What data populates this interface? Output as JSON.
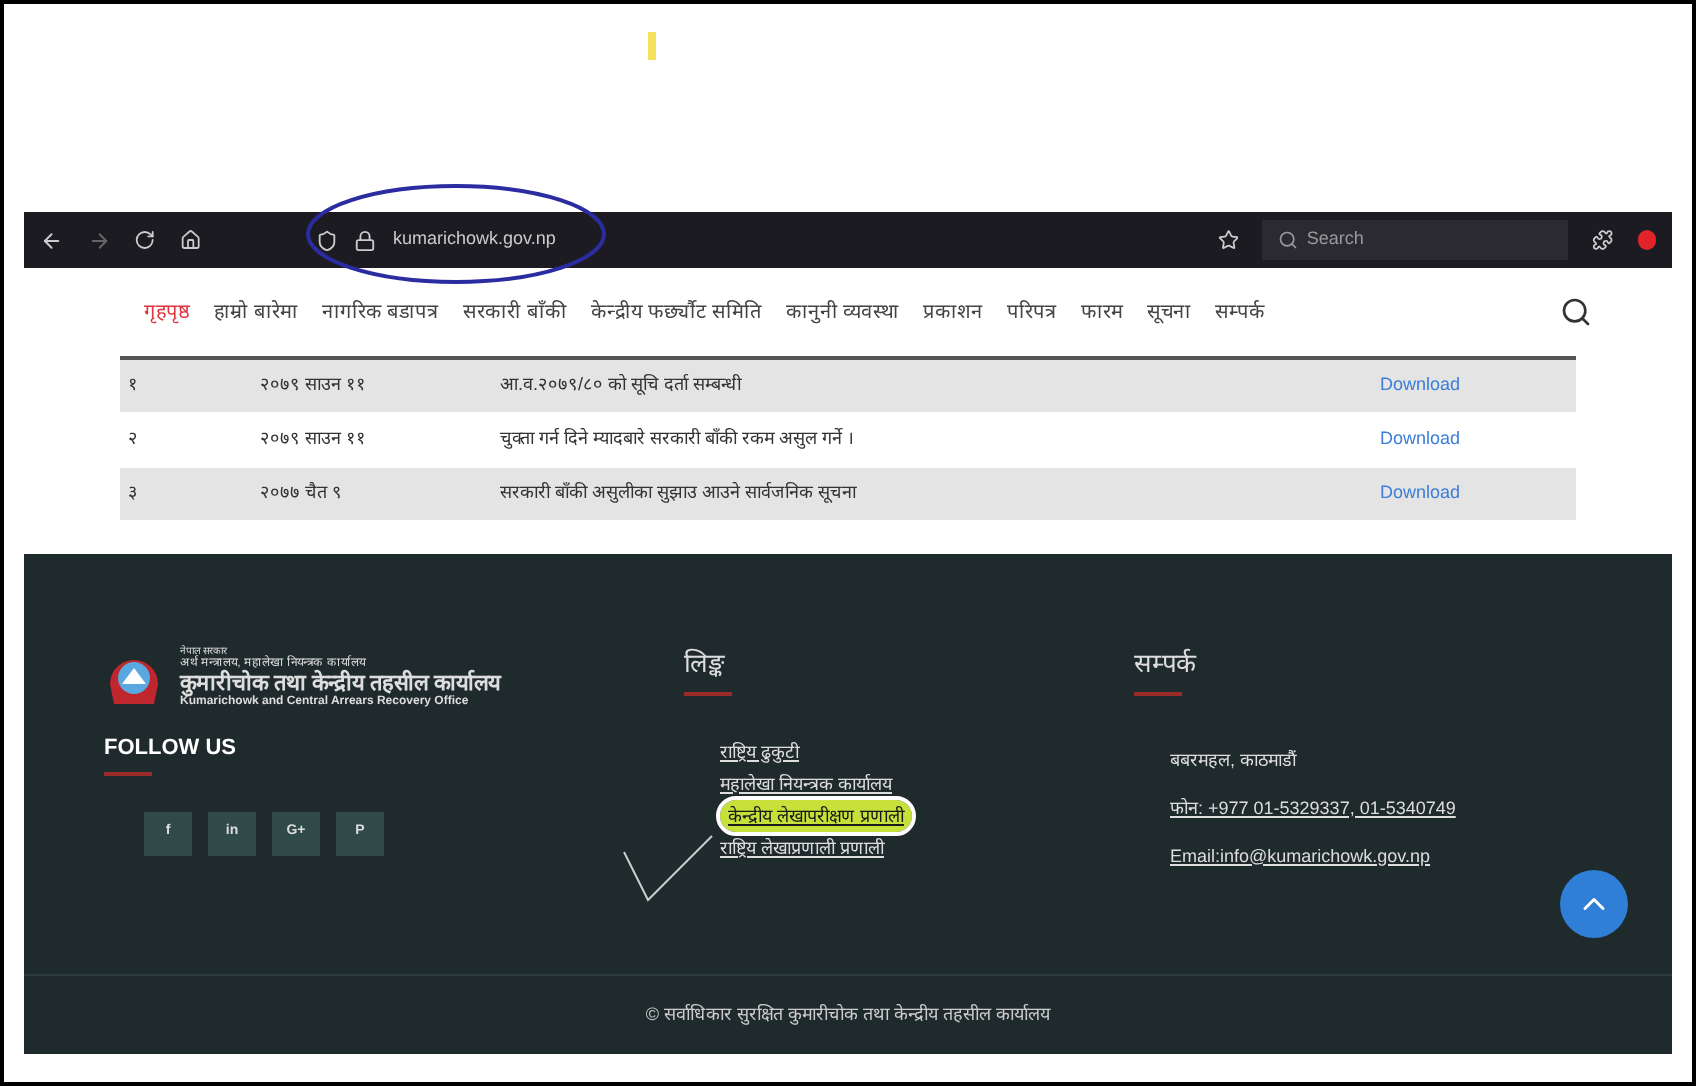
{
  "browser": {
    "url": "kumarichowk.gov.np",
    "search_placeholder": "Search"
  },
  "nav": [
    {
      "label": "गृहपृष्ठ",
      "selected": true
    },
    {
      "label": "हाम्रो बारेमा",
      "selected": false
    },
    {
      "label": "नागरिक बडापत्र",
      "selected": false
    },
    {
      "label": "सरकारी बाँकी",
      "selected": false
    },
    {
      "label": "केन्द्रीय फर्छ्यौट समिति",
      "selected": false
    },
    {
      "label": "कानुनी व्यवस्था",
      "selected": false
    },
    {
      "label": "प्रकाशन",
      "selected": false
    },
    {
      "label": "परिपत्र",
      "selected": false
    },
    {
      "label": "फारम",
      "selected": false
    },
    {
      "label": "सूचना",
      "selected": false
    },
    {
      "label": "सम्पर्क",
      "selected": false
    }
  ],
  "table": {
    "rows": [
      {
        "number": "१",
        "date": "२०७९ साउन ११",
        "title": "आ.व.२०७९/८० को सूचि दर्ता सम्बन्धी",
        "link": "Download"
      },
      {
        "number": "२",
        "date": "२०७९ साउन ११",
        "title": "चुक्ता गर्न दिने म्यादबारे सरकारी बाँकी रकम असुल गर्ने ।",
        "link": "Download"
      },
      {
        "number": "३",
        "date": "२०७७ चैत ९",
        "title": "सरकारी बाँकी असुलीका सुझाउ आउने सार्वजनिक सूचना",
        "link": "Download"
      }
    ]
  },
  "footer": {
    "logo_lines": [
      "नेपाल सरकार",
      "अर्थ मन्त्रालय, महालेखा नियन्त्रक कार्यालय",
      "कुमारीचोक तथा केन्द्रीय तहसील कार्यालय",
      "Kumarichowk and Central Arrears Recovery Office"
    ],
    "follow_title": "FOLLOW US",
    "social": [
      "f",
      "in",
      "G+",
      "P"
    ],
    "links_title": "लिङ्क",
    "links": [
      {
        "label": "राष्ट्रिय ढुकुटी",
        "highlighted": false
      },
      {
        "label": "महालेखा नियन्त्रक कार्यालय",
        "highlighted": false
      },
      {
        "label": "केन्द्रीय लेखापरीक्षण प्रणाली",
        "highlighted": true
      },
      {
        "label": "राष्ट्रिय लेखाप्रणाली प्रणाली",
        "highlighted": false
      }
    ],
    "contact_title": "सम्पर्क",
    "address": "बबरमहल, काठमाडौं",
    "phone": "फोन: +977 01-5329337, 01-5340749",
    "email": "Email:info@kumarichowk.gov.np",
    "copyright": "© सर्वाधिकार सुरक्षित कुमारीचोक तथा केन्द्रीय तहसील कार्यालय"
  }
}
